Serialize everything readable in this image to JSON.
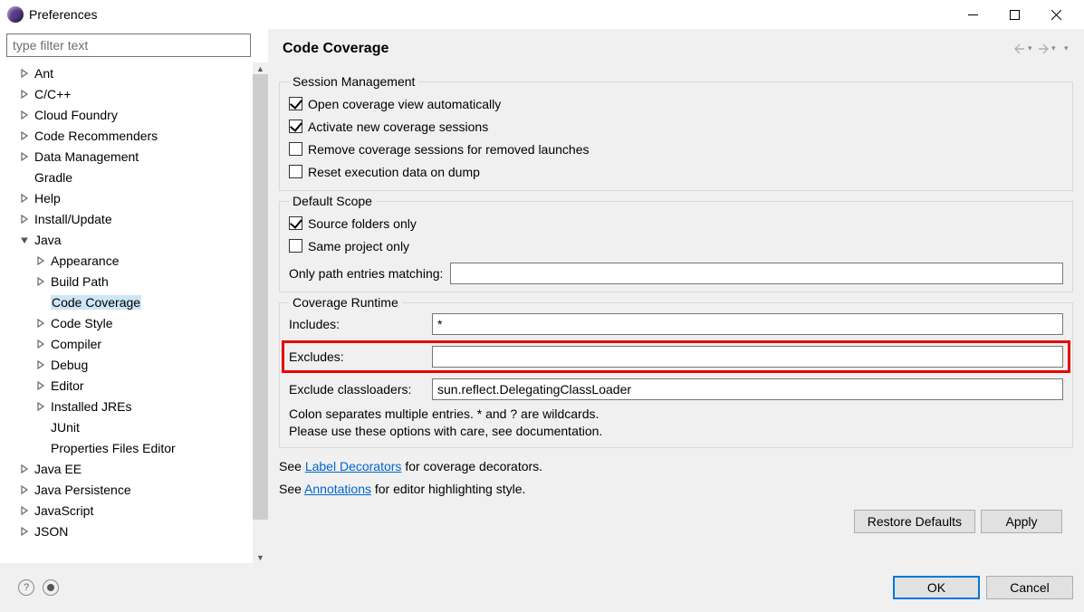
{
  "window": {
    "title": "Preferences"
  },
  "filter": {
    "placeholder": "type filter text"
  },
  "tree": [
    {
      "label": "Ant",
      "level": 0,
      "twisty": "closed"
    },
    {
      "label": "C/C++",
      "level": 0,
      "twisty": "closed"
    },
    {
      "label": "Cloud Foundry",
      "level": 0,
      "twisty": "closed"
    },
    {
      "label": "Code Recommenders",
      "level": 0,
      "twisty": "closed"
    },
    {
      "label": "Data Management",
      "level": 0,
      "twisty": "closed"
    },
    {
      "label": "Gradle",
      "level": 0,
      "twisty": "none"
    },
    {
      "label": "Help",
      "level": 0,
      "twisty": "closed"
    },
    {
      "label": "Install/Update",
      "level": 0,
      "twisty": "closed"
    },
    {
      "label": "Java",
      "level": 0,
      "twisty": "open"
    },
    {
      "label": "Appearance",
      "level": 1,
      "twisty": "closed"
    },
    {
      "label": "Build Path",
      "level": 1,
      "twisty": "closed"
    },
    {
      "label": "Code Coverage",
      "level": 1,
      "twisty": "none",
      "selected": true
    },
    {
      "label": "Code Style",
      "level": 1,
      "twisty": "closed"
    },
    {
      "label": "Compiler",
      "level": 1,
      "twisty": "closed"
    },
    {
      "label": "Debug",
      "level": 1,
      "twisty": "closed"
    },
    {
      "label": "Editor",
      "level": 1,
      "twisty": "closed"
    },
    {
      "label": "Installed JREs",
      "level": 1,
      "twisty": "closed"
    },
    {
      "label": "JUnit",
      "level": 1,
      "twisty": "none"
    },
    {
      "label": "Properties Files Editor",
      "level": 1,
      "twisty": "none"
    },
    {
      "label": "Java EE",
      "level": 0,
      "twisty": "closed"
    },
    {
      "label": "Java Persistence",
      "level": 0,
      "twisty": "closed"
    },
    {
      "label": "JavaScript",
      "level": 0,
      "twisty": "closed"
    },
    {
      "label": "JSON",
      "level": 0,
      "twisty": "closed"
    }
  ],
  "page": {
    "title": "Code Coverage",
    "session": {
      "legend": "Session Management",
      "opt1": {
        "label": "Open coverage view automatically",
        "checked": true
      },
      "opt2": {
        "label": "Activate new coverage sessions",
        "checked": true
      },
      "opt3": {
        "label": "Remove coverage sessions for removed launches",
        "checked": false
      },
      "opt4": {
        "label": "Reset execution data on dump",
        "checked": false
      }
    },
    "scope": {
      "legend": "Default Scope",
      "opt1": {
        "label": "Source folders only",
        "checked": true
      },
      "opt2": {
        "label": "Same project only",
        "checked": false
      },
      "pathLabel": "Only path entries matching:",
      "pathValue": ""
    },
    "runtime": {
      "legend": "Coverage Runtime",
      "includesLabel": "Includes:",
      "includesValue": "*",
      "excludesLabel": "Excludes:",
      "excludesValue": "",
      "exclClsLabel": "Exclude classloaders:",
      "exclClsValue": "sun.reflect.DelegatingClassLoader",
      "hint1": "Colon separates multiple entries. * and ? are wildcards.",
      "hint2": "Please use these options with care, see documentation."
    },
    "links": {
      "seeDecorators": "See ",
      "decoratorsLink": "Label Decorators",
      "decoratorsAfter": " for coverage decorators.",
      "seeAnnotations": "See ",
      "annotationsLink": "Annotations",
      "annotationsAfter": " for editor highlighting style."
    },
    "restoreDefaults": "Restore Defaults",
    "apply": "Apply"
  },
  "footer": {
    "ok": "OK",
    "cancel": "Cancel"
  }
}
